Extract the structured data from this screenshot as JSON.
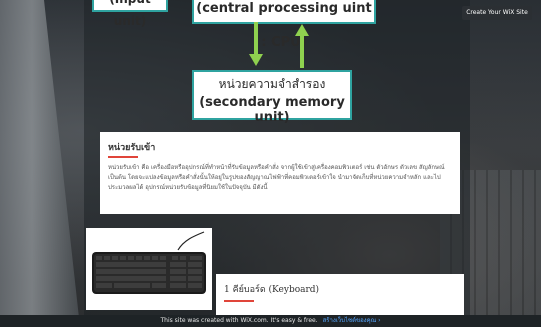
{
  "diagram": {
    "input_unit_label": "(Input unit)",
    "cpu_label": "(central processing uint : CPU)",
    "memory_th": "หน่วยความจำสำรอง",
    "memory_en": "(secondary memory unit)"
  },
  "wix_button": "Create Your WiX Site",
  "info_card": {
    "title": "หน่วยรับเข้า",
    "body": "หน่วยรับเข้า คือ เครื่องมือหรืออุปกรณ์ที่ทำหน้าที่รับข้อมูลหรือคำสั่ง จากผู้ใช้เข้าสู่เครื่องคอมพิวเตอร์ เช่น ตัวอักษร ตัวเลข สัญลักษณ์ เป็นต้น โดยจะแปลงข้อมูลหรือคำสั่งนั้นให้อยู่ในรูปของสัญญาณไฟฟ้าที่คอมพิวเตอร์เข้าใจ นำมาจัดเก็บที่หน่วยความจำหลัก และไปประมวลผลได้ อุปกรณ์หน่วยรับข้อมูลที่นิยมใช้ในปัจจุบัน มีดังนี้"
  },
  "keyboard_card": {
    "title": "1 คีย์บอร์ด (Keyboard)"
  },
  "footer": {
    "text": "This site was created with WiX.com. It's easy & free.",
    "cta": "สร้างเว็บไซต์ของคุณ ›"
  },
  "colors": {
    "node_border": "#2fa3a0",
    "arrow": "#8fd14f",
    "accent_rule": "#e0453a",
    "footer_link": "#57a7ff"
  }
}
